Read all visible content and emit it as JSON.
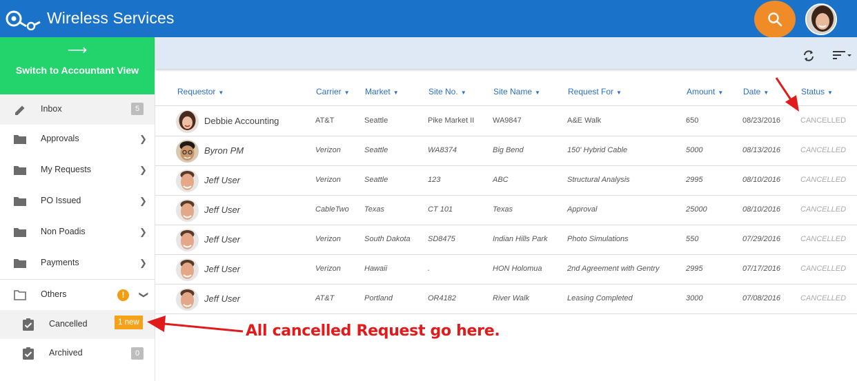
{
  "app": {
    "title": "Wireless Services"
  },
  "sidebar": {
    "switch_arrow": "⟶",
    "switch_label": "Switch to Accountant View",
    "items": [
      {
        "label": "Inbox",
        "icon": "pencil-icon",
        "count": "5"
      },
      {
        "label": "Approvals",
        "icon": "folder-icon"
      },
      {
        "label": "My Requests",
        "icon": "folder-icon"
      },
      {
        "label": "PO Issued",
        "icon": "folder-icon"
      },
      {
        "label": "Non Poadis",
        "icon": "folder-icon"
      },
      {
        "label": "Payments",
        "icon": "folder-icon"
      },
      {
        "label": "Others",
        "icon": "folder-open-icon",
        "alert": "!"
      }
    ],
    "sub_items": [
      {
        "label": "Cancelled",
        "icon": "checked-clipboard-icon",
        "badge": "1 new"
      },
      {
        "label": "Archived",
        "icon": "checked-clipboard-icon",
        "count": "0"
      }
    ]
  },
  "table": {
    "columns": [
      "Requestor",
      "Carrier",
      "Market",
      "Site No.",
      "Site Name",
      "Request For",
      "Amount",
      "Date",
      "Status"
    ],
    "rows": [
      {
        "requestor": "Debbie Accounting",
        "carrier": "AT&T",
        "market": "Seattle",
        "site_no": "Pike Market II",
        "site_name": "WA9847",
        "request_for": "A&E Walk",
        "amount": "650",
        "date": "08/23/2016",
        "status": "CANCELLED"
      },
      {
        "requestor": "Byron PM",
        "carrier": "Verizon",
        "market": "Seattle",
        "site_no": "WA8374",
        "site_name": "Big Bend",
        "request_for": "150' Hybrid Cable",
        "amount": "5000",
        "date": "08/13/2016",
        "status": "CANCELLED"
      },
      {
        "requestor": "Jeff User",
        "carrier": "Verizon",
        "market": "Seattle",
        "site_no": "123",
        "site_name": "ABC",
        "request_for": "Structural Analysis",
        "amount": "2995",
        "date": "08/10/2016",
        "status": "CANCELLED"
      },
      {
        "requestor": "Jeff User",
        "carrier": "CableTwo",
        "market": "Texas",
        "site_no": "CT 101",
        "site_name": "Texas",
        "request_for": "Approval",
        "amount": "25000",
        "date": "08/10/2016",
        "status": "CANCELLED"
      },
      {
        "requestor": "Jeff User",
        "carrier": "Verizon",
        "market": "South Dakota",
        "site_no": "SD8475",
        "site_name": "Indian Hills Park",
        "request_for": "Photo Simulations",
        "amount": "550",
        "date": "07/29/2016",
        "status": "CANCELLED"
      },
      {
        "requestor": "Jeff User",
        "carrier": "Verizon",
        "market": "Hawaii",
        "site_no": ".",
        "site_name": "HON Holomua",
        "request_for": "2nd Agreement with Gentry",
        "amount": "2995",
        "date": "07/17/2016",
        "status": "CANCELLED"
      },
      {
        "requestor": "Jeff User",
        "carrier": "AT&T",
        "market": "Portland",
        "site_no": "OR4182",
        "site_name": "River Walk",
        "request_for": "Leasing Completed",
        "amount": "3000",
        "date": "07/08/2016",
        "status": "CANCELLED"
      }
    ]
  },
  "annotation": {
    "text": "All cancelled Request go here.",
    "color": "#e11b1b"
  },
  "colors": {
    "header": "#1a72c9",
    "switch": "#22d46b",
    "search": "#f08c28",
    "badge": "#f5a21a",
    "link": "#2b6fc4"
  }
}
